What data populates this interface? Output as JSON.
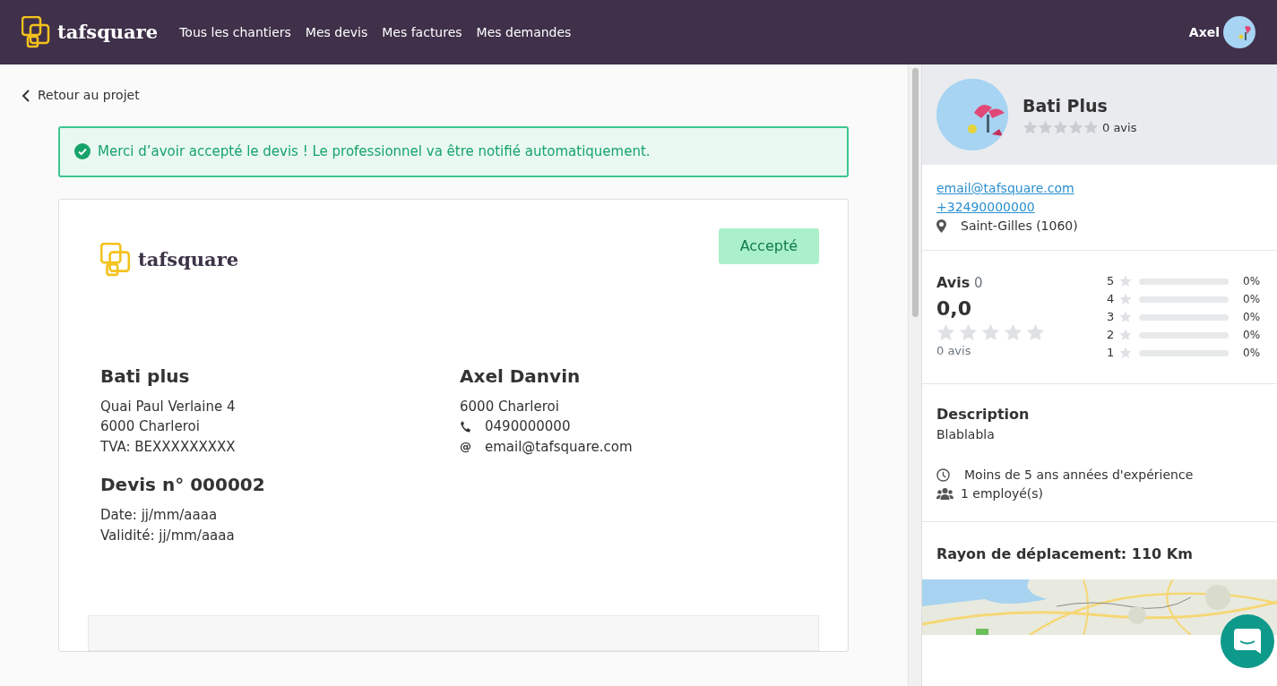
{
  "navbar": {
    "brand": "tafsquare",
    "links": [
      {
        "label": "Tous les chantiers",
        "selected": false
      },
      {
        "label": "Mes devis",
        "selected": false
      },
      {
        "label": "Mes factures",
        "selected": false
      },
      {
        "label": "Mes demandes",
        "selected": false
      }
    ],
    "user": "Axel"
  },
  "back_link": "Retour au projet",
  "alert": "Merci d’avoir accepté le devis ! Le professionnel va être notifié automatiquement.",
  "quote": {
    "brand": "tafsquare",
    "status": "Accepté",
    "issuer": {
      "name": "Bati plus",
      "lines": [
        "Quai Paul Verlaine 4",
        "6000 Charleroi",
        "TVA: BEXXXXXXXXX"
      ]
    },
    "client": {
      "name": "Axel Danvin",
      "city": "6000 Charleroi",
      "phone": "0490000000",
      "email_icon": "@",
      "email": "email@tafsquare.com"
    },
    "number": "Devis n° 000002",
    "date": "Date: jj/mm/aaaa",
    "validity": "Validité: jj/mm/aaaa"
  },
  "sidebar": {
    "name": "Bati Plus",
    "stars": 0,
    "reviews": "0 avis",
    "email": "email@tafsquare.com",
    "phone": "+32490000000",
    "location": "Saint-Gilles (1060)",
    "avis_title": "Avis",
    "avis_count": "0",
    "score": {
      "value": "0,0",
      "stars": 0,
      "reviews": "0 avis"
    },
    "breakdown": [
      {
        "label": "5",
        "level": 0,
        "percent": "0%"
      },
      {
        "label": "4",
        "level": 0,
        "percent": "0%"
      },
      {
        "label": "3",
        "level": 0,
        "percent": "0%"
      },
      {
        "label": "2",
        "level": 0,
        "percent": "0%"
      },
      {
        "label": "1",
        "level": 0,
        "percent": "0%"
      }
    ],
    "description_title": "Description",
    "description": "Blablabla",
    "experience": "Moins de 5 ans années d'expérience",
    "employees": "1 employé(s)",
    "radius": "Rayon de déplacement: 110 Km"
  }
}
